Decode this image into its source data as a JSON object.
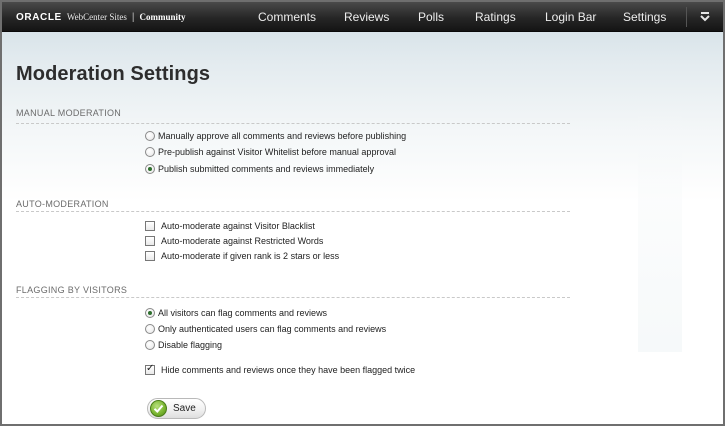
{
  "brand": {
    "vendor": "ORACLE",
    "product": "WebCenter Sites",
    "separator": "|",
    "module": "Community"
  },
  "nav": {
    "items": [
      {
        "label": "Comments"
      },
      {
        "label": "Reviews"
      },
      {
        "label": "Polls"
      },
      {
        "label": "Ratings"
      },
      {
        "label": "Login Bar"
      },
      {
        "label": "Settings"
      }
    ],
    "menu_icon": "chevron-down-icon"
  },
  "page": {
    "title": "Moderation Settings"
  },
  "manual": {
    "heading": "MANUAL MODERATION",
    "options": [
      {
        "label": "Manually approve all comments and reviews before publishing",
        "selected": false
      },
      {
        "label": "Pre-publish against Visitor Whitelist before manual approval",
        "selected": false
      },
      {
        "label": "Publish submitted comments and reviews immediately",
        "selected": true
      }
    ]
  },
  "auto": {
    "heading": "AUTO-MODERATION",
    "options": [
      {
        "label": "Auto-moderate against Visitor Blacklist",
        "checked": false
      },
      {
        "label": "Auto-moderate against Restricted Words",
        "checked": false
      },
      {
        "label": "Auto-moderate if given rank is 2 stars or less",
        "checked": false
      }
    ]
  },
  "flagging": {
    "heading": "FLAGGING BY VISITORS",
    "options": [
      {
        "label": "All visitors can flag comments and reviews",
        "selected": true
      },
      {
        "label": "Only authenticated users can flag comments and reviews",
        "selected": false
      },
      {
        "label": "Disable flagging",
        "selected": false
      }
    ],
    "hide_option": {
      "label": "Hide comments and reviews once they have been flagged twice",
      "checked": true
    }
  },
  "actions": {
    "save_label": "Save",
    "save_icon": "check-icon"
  },
  "colors": {
    "topbar": "#1f1f1f",
    "save_icon": "#7cb733",
    "radio_dot": "#2e6f2e"
  }
}
